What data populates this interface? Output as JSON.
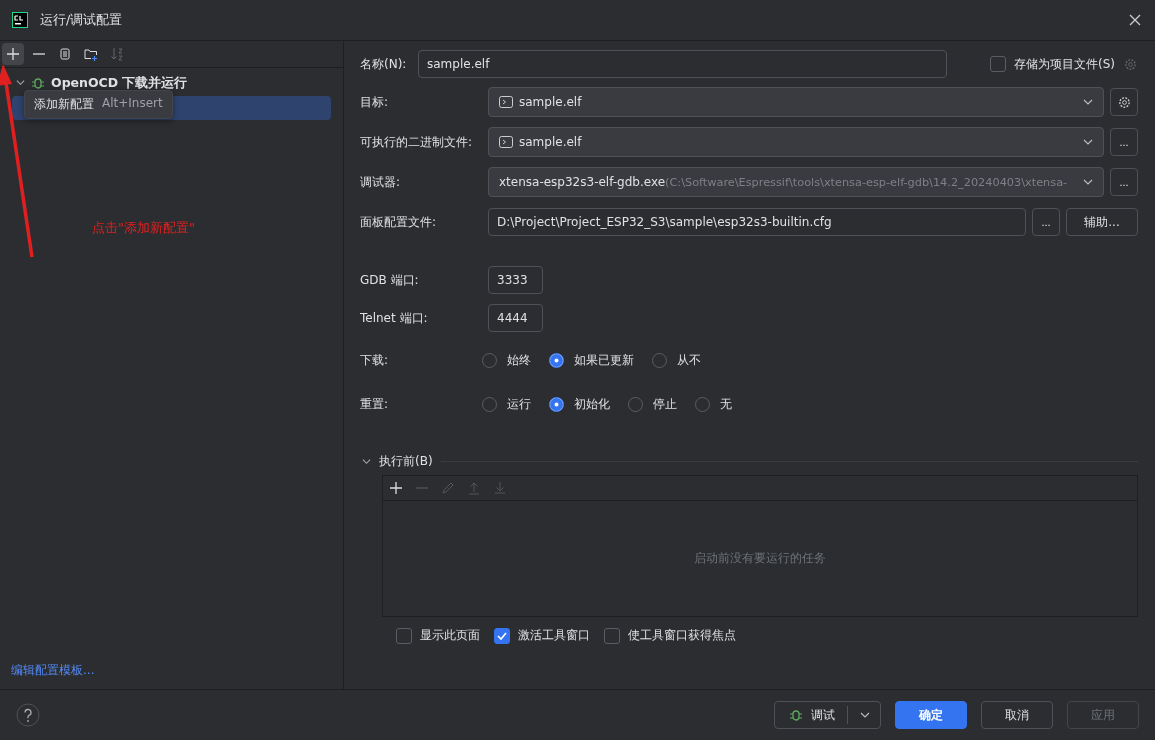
{
  "window": {
    "title": "运行/调试配置"
  },
  "toolbar": {
    "tooltip": {
      "label": "添加新配置",
      "shortcut": "Alt+Insert"
    }
  },
  "tree": [
    {
      "label": "OpenOCD 下载并运行",
      "expanded": true,
      "children": [
        {
          "selected": true
        }
      ]
    }
  ],
  "annotation": {
    "text": "点击\"添加新配置\""
  },
  "edit_templates_link": "编辑配置模板...",
  "form": {
    "name_label": "名称(N):",
    "name_value": "sample.elf",
    "store_as_project_file": {
      "label": "存储为项目文件(S)",
      "checked": false
    },
    "rows": [
      {
        "kind": "combo",
        "label": "目标:",
        "value": "sample.elf",
        "button": {
          "kind": "settings"
        }
      },
      {
        "kind": "combo",
        "label": "可执行的二进制文件:",
        "value": "sample.elf",
        "button": {
          "kind": "browse",
          "label": "..."
        }
      },
      {
        "kind": "debugger",
        "label": "调试器:",
        "value": "xtensa-esp32s3-elf-gdb.exe",
        "hint": "(C:\\Software\\Espressif\\tools\\xtensa-esp-elf-gdb\\14.2_20240403\\xtensa-",
        "button": {
          "kind": "browse",
          "label": "..."
        }
      },
      {
        "kind": "file",
        "label": "面板配置文件:",
        "value": "D:\\Project\\Project_ESP32_S3\\sample\\esp32s3-builtin.cfg",
        "button": {
          "kind": "browse",
          "label": "..."
        },
        "extra_button": "辅助..."
      }
    ],
    "ports": [
      {
        "label": "GDB 端口:",
        "value": "3333"
      },
      {
        "label": "Telnet 端口:",
        "value": "4444"
      }
    ],
    "radio_groups": [
      {
        "label": "下载:",
        "options": [
          {
            "label": "始终",
            "selected": false
          },
          {
            "label": "如果已更新",
            "selected": true
          },
          {
            "label": "从不",
            "selected": false
          }
        ]
      },
      {
        "label": "重置:",
        "options": [
          {
            "label": "运行",
            "selected": false
          },
          {
            "label": "初始化",
            "selected": true
          },
          {
            "label": "停止",
            "selected": false
          },
          {
            "label": "无",
            "selected": false
          }
        ]
      }
    ],
    "before_launch": {
      "title": "执行前(B)",
      "expanded": true,
      "empty_text": "启动前没有要运行的任务"
    },
    "checkboxes": [
      {
        "label": "显示此页面",
        "checked": false
      },
      {
        "label": "激活工具窗口",
        "checked": true
      },
      {
        "label": "使工具窗口获得焦点",
        "checked": false
      }
    ]
  },
  "footer": {
    "debug_button": "调试",
    "ok": "确定",
    "cancel": "取消",
    "apply": {
      "label": "应用",
      "disabled": true
    }
  }
}
